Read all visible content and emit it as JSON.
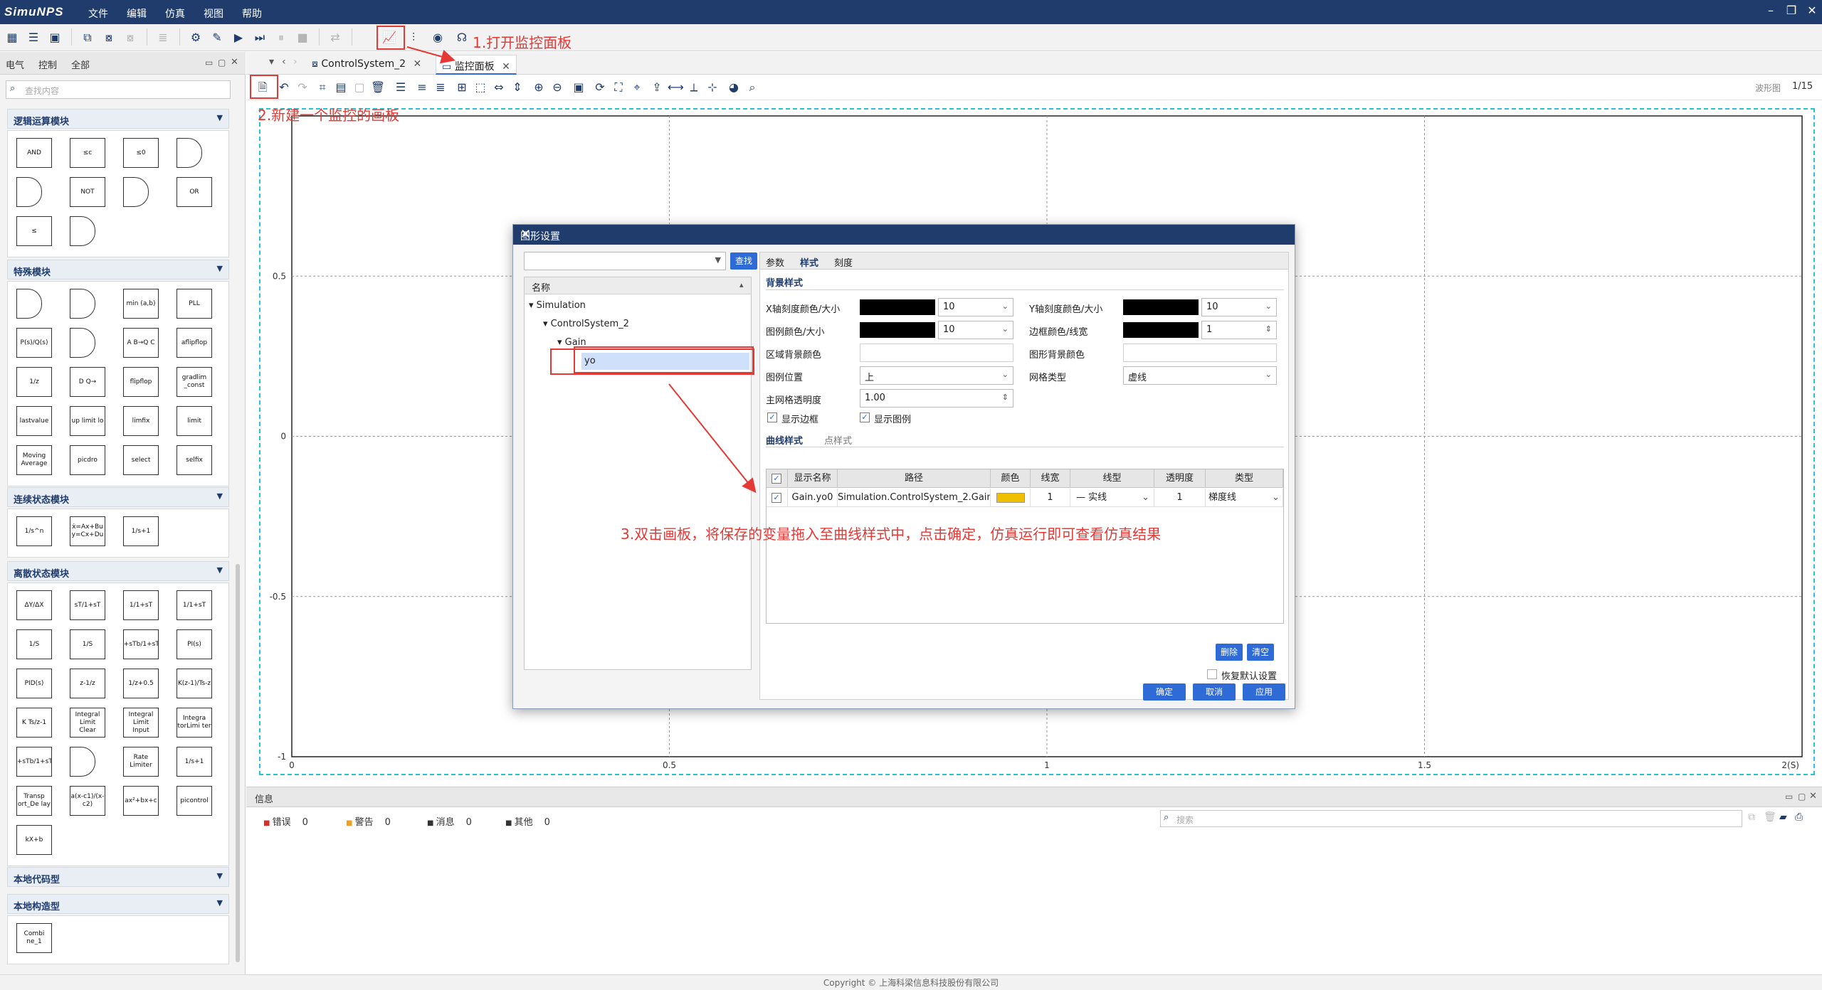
{
  "app": {
    "logo": "SimuNPS",
    "menu": [
      "文件",
      "编辑",
      "仿真",
      "视图",
      "帮助"
    ]
  },
  "left_panel": {
    "tabs": [
      "电气",
      "控制",
      "全部"
    ],
    "search_placeholder": "查找内容",
    "sections": [
      {
        "title": "逻辑运算模块",
        "blocks": [
          "AND",
          "≤c",
          "≤0",
          "",
          "",
          "NOT",
          "",
          "OR",
          "≤",
          ""
        ]
      },
      {
        "title": "特殊模块",
        "blocks": [
          "",
          "",
          "min (a,b)",
          "PLL",
          "P(s)/Q(s)",
          "",
          "A B→Q C",
          "aflipflop",
          "1/z",
          "D Q→",
          "flipflop",
          "gradlim _const",
          "lastvalue",
          "up limit lo",
          "limfix",
          "limit",
          "Moving Average",
          "picdro",
          "select",
          "selfix"
        ]
      },
      {
        "title": "连续状态模块",
        "blocks": [
          "1/s^n",
          "ẋ=Ax+Bu y=Cx+Du",
          "1/s+1"
        ]
      },
      {
        "title": "离散状态模块",
        "blocks": [
          "ΔY/ΔX",
          "sT/1+sT",
          "1/1+sT",
          "1/1+sT",
          "1/S",
          "1/S",
          "1+sTb/1+sTa",
          "PI(s)",
          "PID(s)",
          "z-1/z",
          "1/z+0.5",
          "K(z-1)/Ts-z",
          "K Ts/z-1",
          "Integral Limit Clear",
          "Integral Limit Input",
          "Integra torLimi ter",
          "1+sTb/1+sTa",
          "",
          "Rate Limiter",
          "1/s+1",
          "Transp ort_De lay",
          "a(x-c1)/(x-c2)",
          "ax²+bx+c",
          "picontrol",
          "kX+b"
        ]
      },
      {
        "title": "本地代码型",
        "blocks": []
      },
      {
        "title": "本地构造型",
        "blocks": [
          "Combi ne_1"
        ]
      }
    ]
  },
  "doc_tabs": [
    {
      "label": "ControlSystem_2",
      "active": false
    },
    {
      "label": "监控面板",
      "active": true
    }
  ],
  "page_indicator": {
    "label": "波形图",
    "value": "1/15"
  },
  "chart_data": {
    "type": "line",
    "series": [],
    "x_ticks": [
      "0",
      "0.5",
      "1",
      "1.5",
      "2(S)"
    ],
    "y_ticks": [
      "0.5",
      "0",
      "-0.5",
      "-1"
    ],
    "xlim": [
      0,
      2
    ],
    "ylim": [
      -1,
      1
    ],
    "grid": true,
    "grid_style": "dashed"
  },
  "annotations": {
    "step1": "1.打开监控面板",
    "step2": "2.新建一个监控的画板",
    "step3": "3.双击画板，将保存的变量拖入至曲线样式中，点击确定，仿真运行即可查看仿真结果"
  },
  "dialog": {
    "title": "图形设置",
    "search_button": "查找",
    "tree_header": "名称",
    "tree": [
      "Simulation",
      "ControlSystem_2",
      "Gain",
      "yo"
    ],
    "tabs": [
      "参数",
      "样式",
      "刻度"
    ],
    "bg_section": "背景样式",
    "fields": {
      "x_tick_color_size": "X轴刻度颜色/大小",
      "x_tick_size": "10",
      "y_tick_color_size": "Y轴刻度颜色/大小",
      "y_tick_size": "10",
      "legend_color_size": "图例颜色/大小",
      "legend_size": "10",
      "border_color_width": "边框颜色/线宽",
      "border_width": "1",
      "area_bg_color": "区域背景颜色",
      "plot_bg_color": "图形背景颜色",
      "legend_position": "图例位置",
      "legend_position_value": "上",
      "grid_type": "网格类型",
      "grid_type_value": "虚线",
      "grid_alpha": "主网格透明度",
      "grid_alpha_value": "1.00",
      "show_border": "显示边框",
      "show_legend": "显示图例"
    },
    "curve_tabs": [
      "曲线样式",
      "点样式"
    ],
    "table": {
      "headers": [
        "显示名称",
        "路径",
        "颜色",
        "线宽",
        "线型",
        "透明度",
        "类型"
      ],
      "rows": [
        {
          "name": "Gain.yo0",
          "path": "Simulation.ControlSystem_2.Gain.yo",
          "color": "#f0c000",
          "width": "1",
          "style": "实线",
          "alpha": "1",
          "type": "梯度线"
        }
      ]
    },
    "delete_button": "删除",
    "clear_button": "清空",
    "restore_default": "恢复默认设置",
    "ok_button": "确定",
    "cancel_button": "取消",
    "apply_button": "应用"
  },
  "info_panel": {
    "title": "信息",
    "counts": [
      {
        "label": "错误",
        "value": "0",
        "color": "#d32f2f"
      },
      {
        "label": "警告",
        "value": "0",
        "color": "#f0a020"
      },
      {
        "label": "消息",
        "value": "0",
        "color": "#333333"
      },
      {
        "label": "其他",
        "value": "0",
        "color": "#333333"
      }
    ],
    "search_placeholder": "搜索"
  },
  "footer": "Copyright © 上海科梁信息科技股份有限公司"
}
